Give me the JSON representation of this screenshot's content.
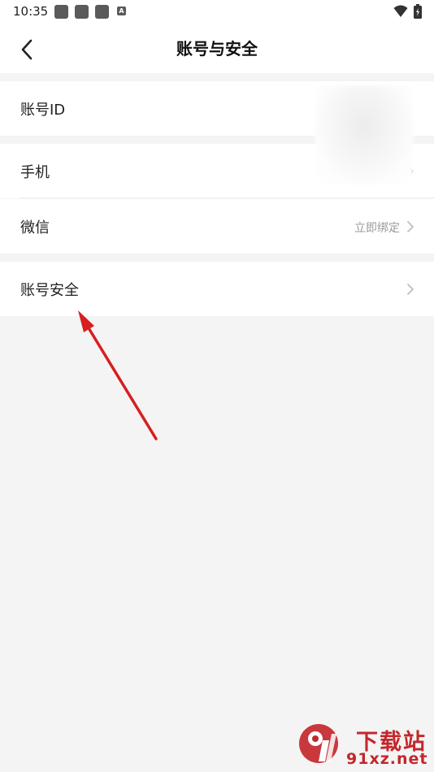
{
  "status_bar": {
    "time": "10:35",
    "icons": [
      "notification-icon",
      "notification-icon",
      "notification-icon",
      "a-icon",
      "wifi-icon",
      "battery-icon"
    ]
  },
  "navbar": {
    "back_icon": "chevron-left-icon",
    "title": "账号与安全"
  },
  "rows": {
    "account_id": {
      "label": "账号ID",
      "value": ""
    },
    "phone": {
      "label": "手机",
      "value": ""
    },
    "wechat": {
      "label": "微信",
      "value": "立即绑定"
    },
    "account_security": {
      "label": "账号安全"
    }
  },
  "watermark": {
    "brand_cn": "下载站",
    "brand_en": "91xz.net"
  },
  "colors": {
    "background": "#f4f4f4",
    "surface": "#ffffff",
    "annotation_arrow": "#d61f1f",
    "watermark": "#c3272b"
  }
}
